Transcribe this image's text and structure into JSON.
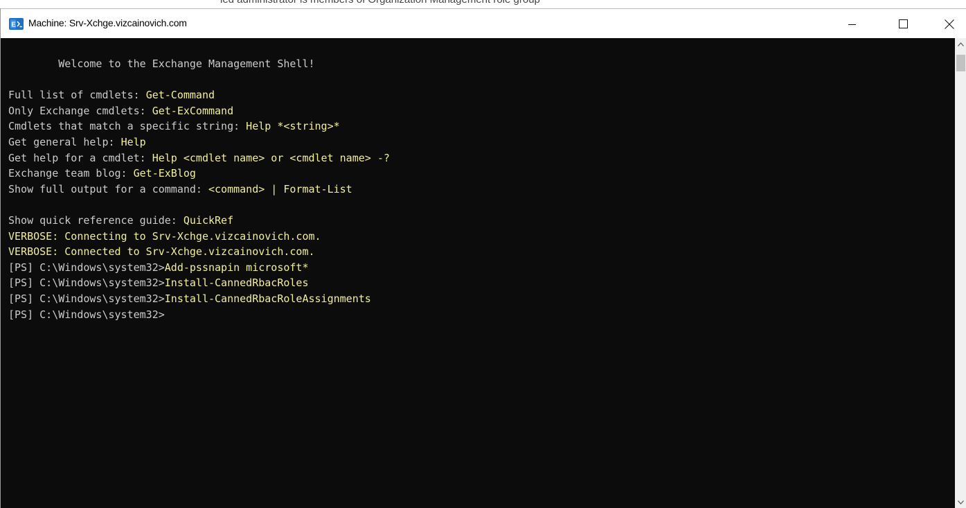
{
  "background_window": {
    "partial_text": "ied administrator is members of Organization Management role group"
  },
  "window": {
    "title": "Machine: Srv-Xchge.vizcainovich.com",
    "icon": "exchange-shell-icon",
    "controls": {
      "minimize": "–",
      "maximize": "☐",
      "close": "✕"
    }
  },
  "console": {
    "colors": {
      "background": "#0c0c0c",
      "text": "#cccccc",
      "highlight": "#f2ef9b"
    },
    "lines": [
      [
        {
          "t": "        Welcome to the Exchange Management Shell!",
          "c": "plain"
        }
      ],
      [],
      [
        {
          "t": "Full list of cmdlets: ",
          "c": "plain"
        },
        {
          "t": "Get-Command",
          "c": "hl"
        }
      ],
      [
        {
          "t": "Only Exchange cmdlets: ",
          "c": "plain"
        },
        {
          "t": "Get-ExCommand",
          "c": "hl"
        }
      ],
      [
        {
          "t": "Cmdlets that match a specific string: ",
          "c": "plain"
        },
        {
          "t": "Help *<string>*",
          "c": "hl"
        }
      ],
      [
        {
          "t": "Get general help: ",
          "c": "plain"
        },
        {
          "t": "Help",
          "c": "hl"
        }
      ],
      [
        {
          "t": "Get help for a cmdlet: ",
          "c": "plain"
        },
        {
          "t": "Help <cmdlet name> or <cmdlet name> -?",
          "c": "hl"
        }
      ],
      [
        {
          "t": "Exchange team blog: ",
          "c": "plain"
        },
        {
          "t": "Get-ExBlog",
          "c": "hl"
        }
      ],
      [
        {
          "t": "Show full output for a command: ",
          "c": "plain"
        },
        {
          "t": "<command> | Format-List",
          "c": "hl"
        }
      ],
      [],
      [
        {
          "t": "Show quick reference guide: ",
          "c": "plain"
        },
        {
          "t": "QuickRef",
          "c": "hl"
        }
      ],
      [
        {
          "t": "VERBOSE: Connecting to Srv-Xchge.vizcainovich.com.",
          "c": "hl"
        }
      ],
      [
        {
          "t": "VERBOSE: Connected to Srv-Xchge.vizcainovich.com.",
          "c": "hl"
        }
      ],
      [
        {
          "t": "[PS] C:\\Windows\\system32>",
          "c": "plain"
        },
        {
          "t": "Add-pssnapin microsoft*",
          "c": "hl"
        }
      ],
      [
        {
          "t": "[PS] C:\\Windows\\system32>",
          "c": "plain"
        },
        {
          "t": "Install-CannedRbacRoles",
          "c": "hl"
        }
      ],
      [
        {
          "t": "[PS] C:\\Windows\\system32>",
          "c": "plain"
        },
        {
          "t": "Install-CannedRbacRoleAssignments",
          "c": "hl"
        }
      ],
      [
        {
          "t": "[PS] C:\\Windows\\system32>",
          "c": "plain"
        }
      ]
    ]
  },
  "scrollbar": {
    "up_icon": "chevron-up-icon",
    "down_icon": "chevron-down-icon"
  }
}
